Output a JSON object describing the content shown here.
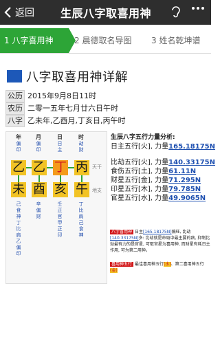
{
  "nav": {
    "back_label": "返回",
    "title": "生辰八字取喜用神"
  },
  "tabs": [
    {
      "label": "1 八字喜用神",
      "active": true
    },
    {
      "label": "2 晨德取名导图",
      "active": false
    },
    {
      "label": "3 姓名乾坤谱",
      "active": false
    }
  ],
  "heading": "八字取喜用神详解",
  "info": {
    "gongli_label": "公历",
    "gongli_value": "2015年9月8日11时",
    "nongli_label": "农历",
    "nongli_value": "二零一五年七月廿六日午时",
    "bazi_label": "八字",
    "bazi_value": "乙未年,乙酉月,丁亥日,丙午时"
  },
  "chart": {
    "headers": [
      "年",
      "月",
      "日",
      "时"
    ],
    "top_gods": [
      [
        "偏",
        "印"
      ],
      [
        "偏",
        "印"
      ],
      [
        "日",
        "主"
      ],
      [
        "劫",
        "财"
      ]
    ],
    "gan": [
      "乙",
      "乙",
      "丁",
      "丙"
    ],
    "zhi": [
      "未",
      "酉",
      "亥",
      "午"
    ],
    "side_top": "天干",
    "side_bottom": "地支",
    "hidden": [
      [
        "己",
        "食",
        "神",
        "丁",
        "比",
        "肩",
        "乙",
        "偏",
        "印"
      ],
      [
        "辛",
        "偏",
        "财"
      ],
      [
        "壬",
        "正",
        "官",
        "甲",
        "正",
        "印"
      ],
      [
        "丁",
        "比",
        "肩",
        "己",
        "食",
        "神"
      ]
    ]
  },
  "analysis": {
    "title": "生辰八字五行力量分析:",
    "rizhu_label": "日主五行[火], 力量",
    "rizhu_value": "165.18175N",
    "rows": [
      {
        "label": "比劫五行[火], 力量",
        "value": "140.33175N"
      },
      {
        "label": "食伤五行[土], 力量",
        "value": "61.11N"
      },
      {
        "label": "财星五行[金], 力量",
        "value": "71.295N"
      },
      {
        "label": "印星五行[木], 力量",
        "value": "79.785N"
      },
      {
        "label": "官星五行[水], 力量",
        "value": "49.9065N"
      }
    ]
  },
  "note1": {
    "tag": "八字喜用神",
    "text_a": "日主",
    "val_a": "[165.18175N]",
    "text_b": "偏旺, 比劫",
    "val_b": "[140.33175N]",
    "text_c": "多: 比劫就是命局中最主要的病, 抑制比劫最有力的是官星, 可取官星为喜用神, 而财星有耗日主作用, 可为第二用神。"
  },
  "note2": {
    "tag": "喜用神五行",
    "text_a": "最佳喜用神五行",
    "hl_a": "(水)",
    "text_b": "、第二喜用神五行",
    "hl_b": "(金)"
  }
}
